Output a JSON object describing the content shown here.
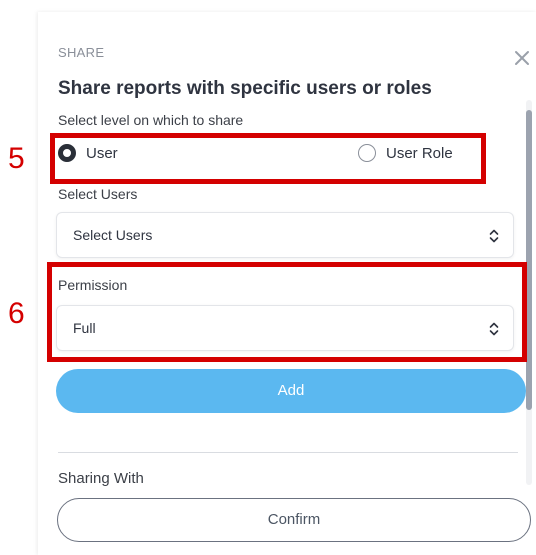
{
  "dialog": {
    "header": "SHARE",
    "title": "Share reports with specific users or roles",
    "level_label": "Select level on which to share",
    "radio_options": [
      {
        "label": "User",
        "checked": true
      },
      {
        "label": "User Role",
        "checked": false
      }
    ],
    "users": {
      "label": "Select Users",
      "value": "Select Users"
    },
    "permission": {
      "label": "Permission",
      "value": "Full"
    },
    "add_label": "Add",
    "sharing_with_label": "Sharing With",
    "confirm_label": "Confirm"
  },
  "annotations": {
    "callout_5": "5",
    "callout_6": "6"
  },
  "colors": {
    "accent": "#5bb8f0",
    "annotation": "#d40000",
    "title_text": "#2f3440"
  },
  "icons": {
    "close": "close-icon",
    "select_chevron": "chevron-up-down-icon"
  }
}
